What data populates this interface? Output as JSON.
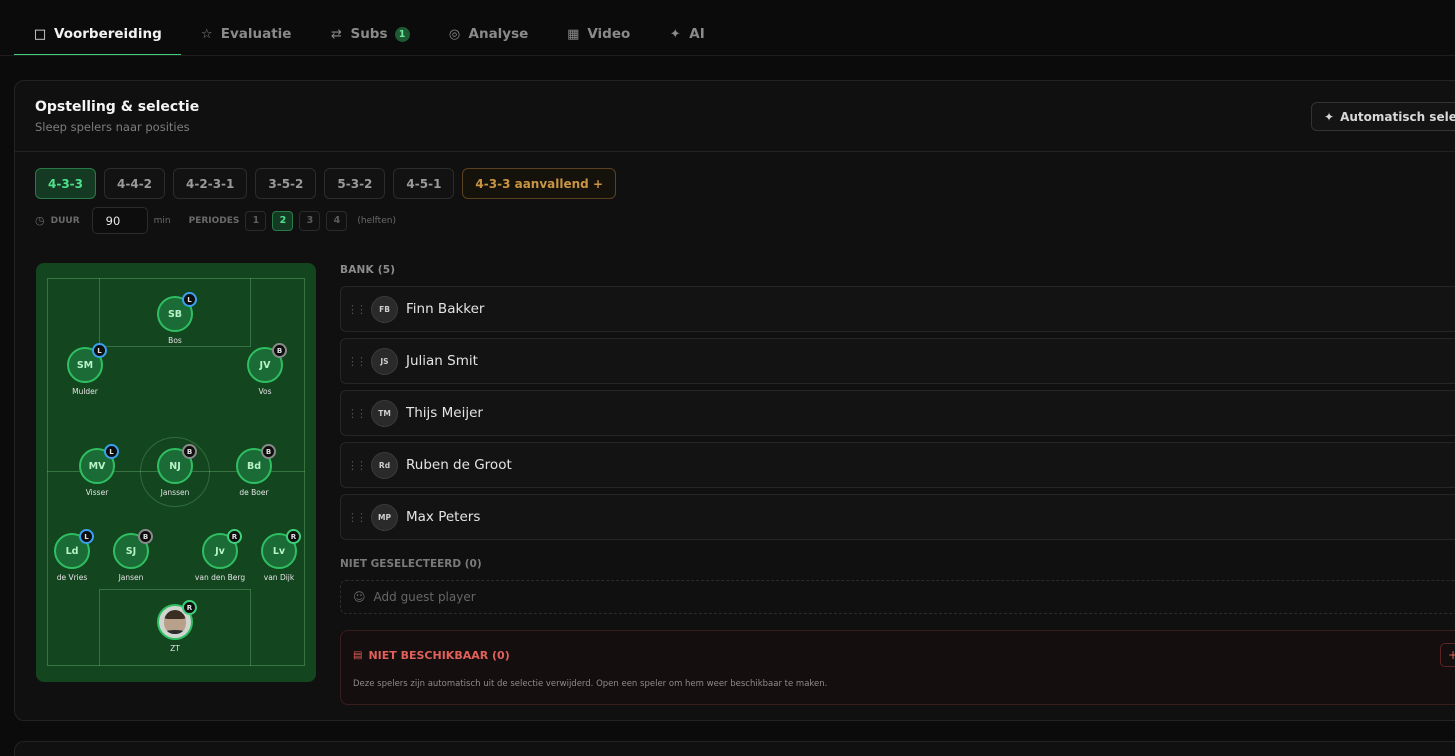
{
  "tabs": [
    {
      "label": "Voorbereiding",
      "icon": "clipboard-icon",
      "active": true
    },
    {
      "label": "Evaluatie",
      "icon": "star-icon"
    },
    {
      "label": "Subs",
      "icon": "swap-icon",
      "count": "1"
    },
    {
      "label": "Analyse",
      "icon": "target-icon"
    },
    {
      "label": "Video",
      "icon": "film-icon"
    },
    {
      "label": "AI",
      "icon": "sparkle-icon"
    }
  ],
  "lineup": {
    "title": "Opstelling & selectie",
    "subtitle": "Sleep spelers naar posities",
    "auto_button": "Automatisch selecteren"
  },
  "formations": [
    "4-3-3",
    "4-4-2",
    "4-2-3-1",
    "3-5-2",
    "5-3-2",
    "4-5-1",
    "4-3-3 aanvallend +"
  ],
  "active_formation": "4-3-3",
  "duration": {
    "label": "DUUR",
    "value": "90",
    "unit": "min",
    "periods_label": "PERIODES",
    "periods": [
      "1",
      "2",
      "3",
      "4"
    ],
    "active_period": "2",
    "periods_hint": "(helften)"
  },
  "field_players": [
    {
      "initials": "SB",
      "name": "Bos",
      "badge": "L"
    },
    {
      "initials": "SM",
      "name": "Mulder",
      "badge": "L"
    },
    {
      "initials": "JV",
      "name": "Vos",
      "badge": "B"
    },
    {
      "initials": "MV",
      "name": "Visser",
      "badge": "L"
    },
    {
      "initials": "NJ",
      "name": "Janssen",
      "badge": "B"
    },
    {
      "initials": "Bd",
      "name": "de Boer",
      "badge": "B"
    },
    {
      "initials": "Ld",
      "name": "de Vries",
      "badge": "L"
    },
    {
      "initials": "SJ",
      "name": "Jansen",
      "badge": "B"
    },
    {
      "initials": "Jv",
      "name": "van den Berg",
      "badge": "R"
    },
    {
      "initials": "Lv",
      "name": "van Dijk",
      "badge": "R"
    },
    {
      "initials": "",
      "name": "ZT",
      "badge": "R"
    }
  ],
  "bank": {
    "label": "BANK (5)",
    "players": [
      {
        "initials": "FB",
        "name": "Finn Bakker"
      },
      {
        "initials": "JS",
        "name": "Julian Smit"
      },
      {
        "initials": "TM",
        "name": "Thijs Meijer"
      },
      {
        "initials": "Rd",
        "name": "Ruben de Groot"
      },
      {
        "initials": "MP",
        "name": "Max Peters"
      }
    ]
  },
  "not_selected": {
    "label": "NIET GESELECTEERD (0)",
    "guest_placeholder": "Add guest player"
  },
  "unavailable": {
    "label": "NIET BESCHIKBAAR (0)",
    "description": "Deze spelers zijn automatisch uit de selectie verwijderd. Open een speler om hem weer beschikbaar te maken.",
    "add": "+"
  },
  "colors": {
    "accent": "#3ed07a",
    "warning": "#c89542",
    "danger": "#e0605a",
    "field": "#13451f"
  }
}
